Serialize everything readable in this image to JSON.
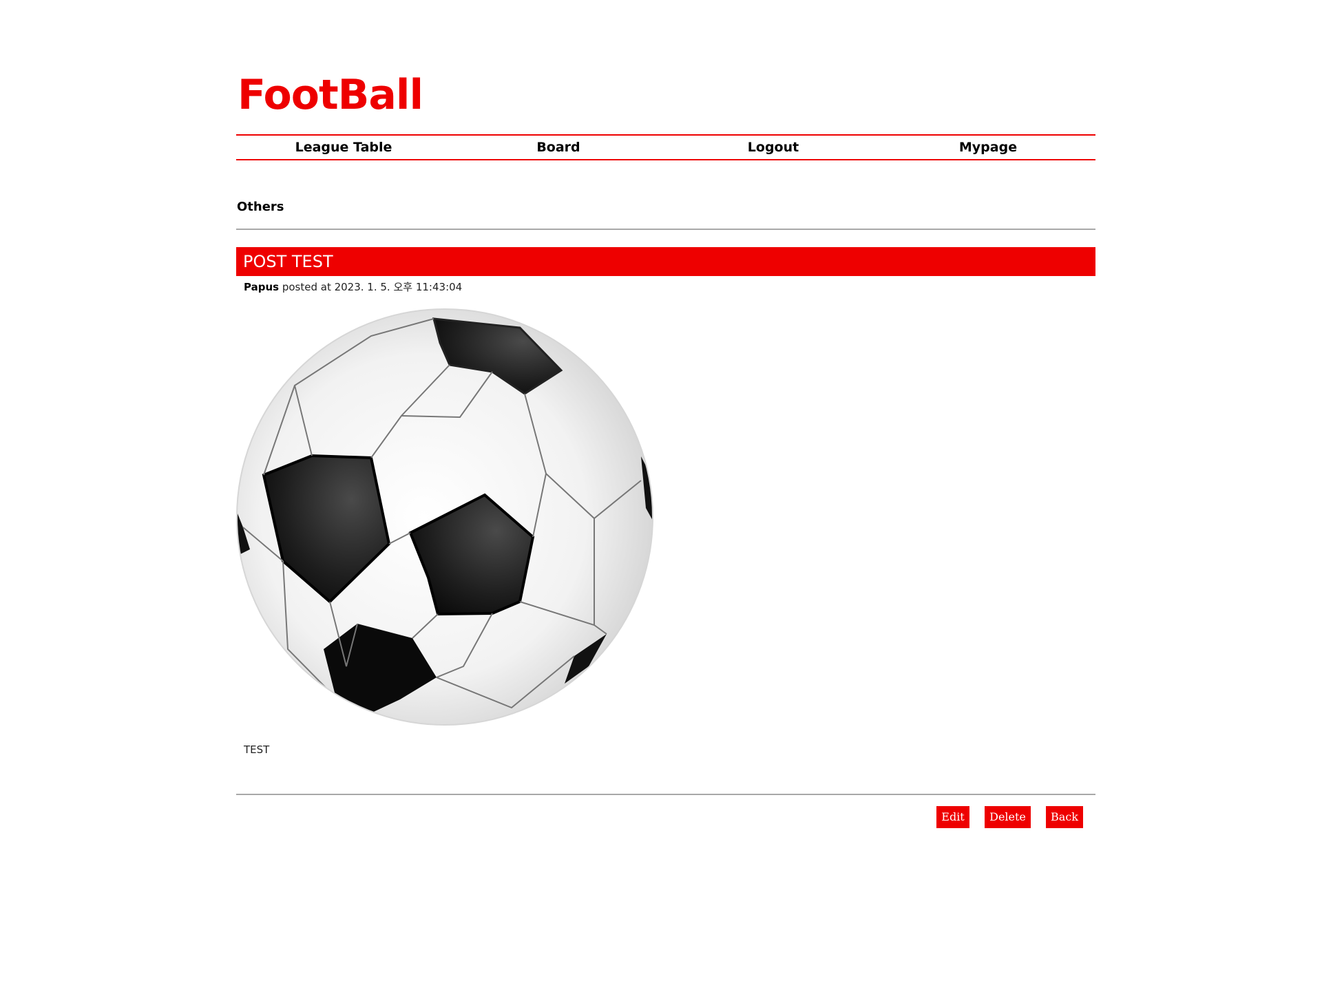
{
  "header": {
    "logo": "FootBall"
  },
  "nav": {
    "items": [
      "League Table",
      "Board",
      "Logout",
      "Mypage"
    ]
  },
  "board": {
    "category": "Others"
  },
  "post": {
    "title": "POST TEST",
    "author": "Papus",
    "posted_text": "posted at 2023. 1. 5. 오후 11:43:04",
    "image": "soccer-ball",
    "body": "TEST"
  },
  "actions": {
    "edit_label": "Edit",
    "delete_label": "Delete",
    "back_label": "Back"
  },
  "colors": {
    "accent": "#ee0000",
    "divider": "#a8a8a8"
  }
}
